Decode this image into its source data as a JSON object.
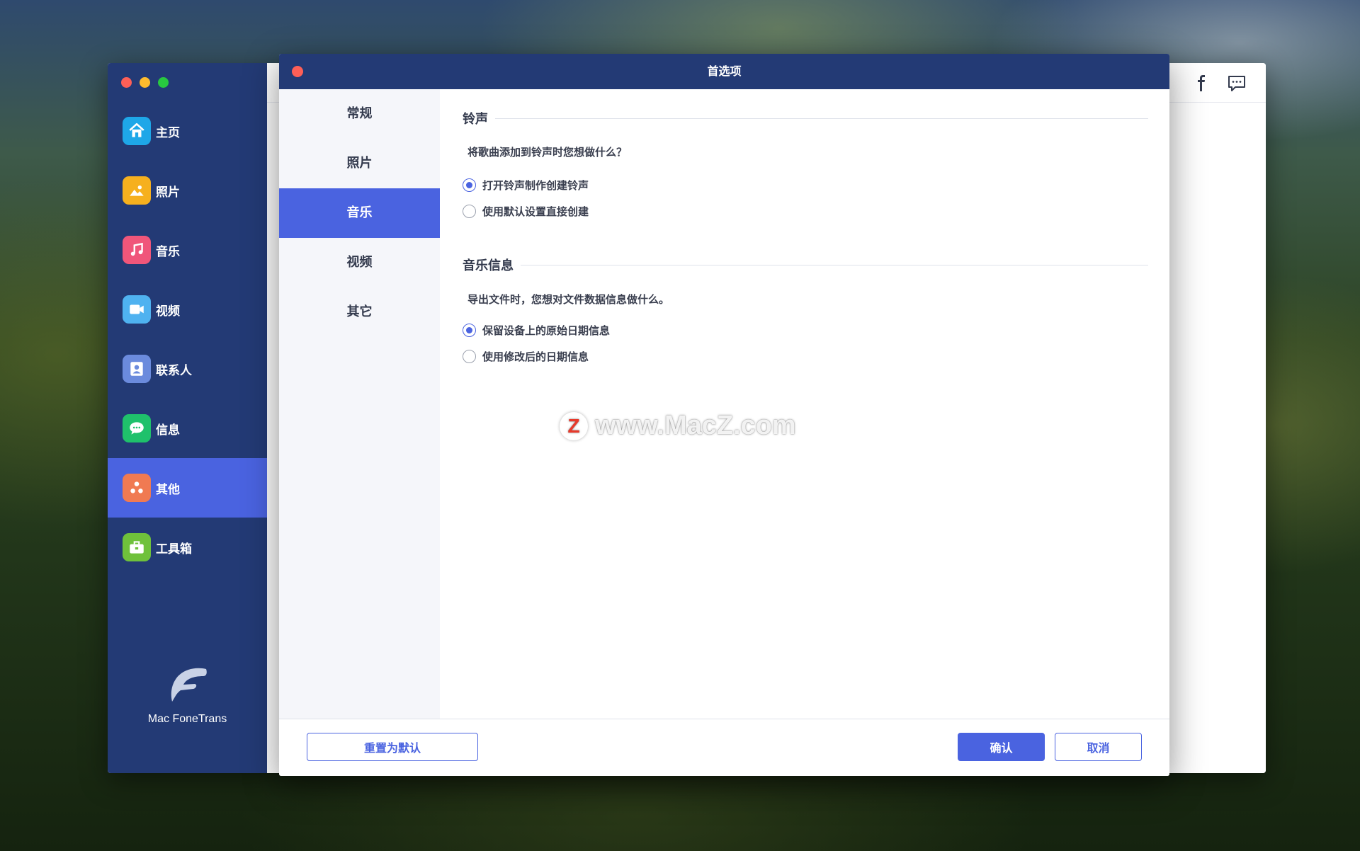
{
  "colors": {
    "sidebar": "#233a75",
    "accent": "#4a63e0",
    "close": "#fe5f57"
  },
  "sidebar": {
    "items": [
      {
        "label": "主页",
        "icon": "home-icon",
        "color": "#1ea7e8"
      },
      {
        "label": "照片",
        "icon": "photo-icon",
        "color": "#f6b01e"
      },
      {
        "label": "音乐",
        "icon": "music-icon",
        "color": "#f0567a"
      },
      {
        "label": "视频",
        "icon": "video-icon",
        "color": "#4fb2f0"
      },
      {
        "label": "联系人",
        "icon": "contact-icon",
        "color": "#6b8bdd"
      },
      {
        "label": "信息",
        "icon": "message-icon",
        "color": "#1fc16b"
      },
      {
        "label": "其他",
        "icon": "other-icon",
        "color": "#f07a52",
        "active": true
      },
      {
        "label": "工具箱",
        "icon": "toolbox-icon",
        "color": "#6fc13b"
      }
    ],
    "brand_name": "Mac FoneTrans"
  },
  "toolbar": {
    "icons": [
      "facebook-icon",
      "feedback-icon"
    ]
  },
  "dialog": {
    "title": "首选项",
    "tabs": [
      "常规",
      "照片",
      "音乐",
      "视频",
      "其它"
    ],
    "active_tab": "音乐",
    "sections": [
      {
        "title": "铃声",
        "question": "将歌曲添加到铃声时您想做什么？",
        "options": [
          {
            "label": "打开铃声制作创建铃声",
            "checked": true
          },
          {
            "label": "使用默认设置直接创建",
            "checked": false
          }
        ]
      },
      {
        "title": "音乐信息",
        "question": "导出文件时，您想对文件数据信息做什么。",
        "options": [
          {
            "label": "保留设备上的原始日期信息",
            "checked": true
          },
          {
            "label": "使用修改后的日期信息",
            "checked": false
          }
        ]
      }
    ],
    "buttons": {
      "reset": "重置为默认",
      "confirm": "确认",
      "cancel": "取消"
    }
  },
  "watermark": {
    "badge": "Z",
    "text": "www.MacZ.com"
  }
}
